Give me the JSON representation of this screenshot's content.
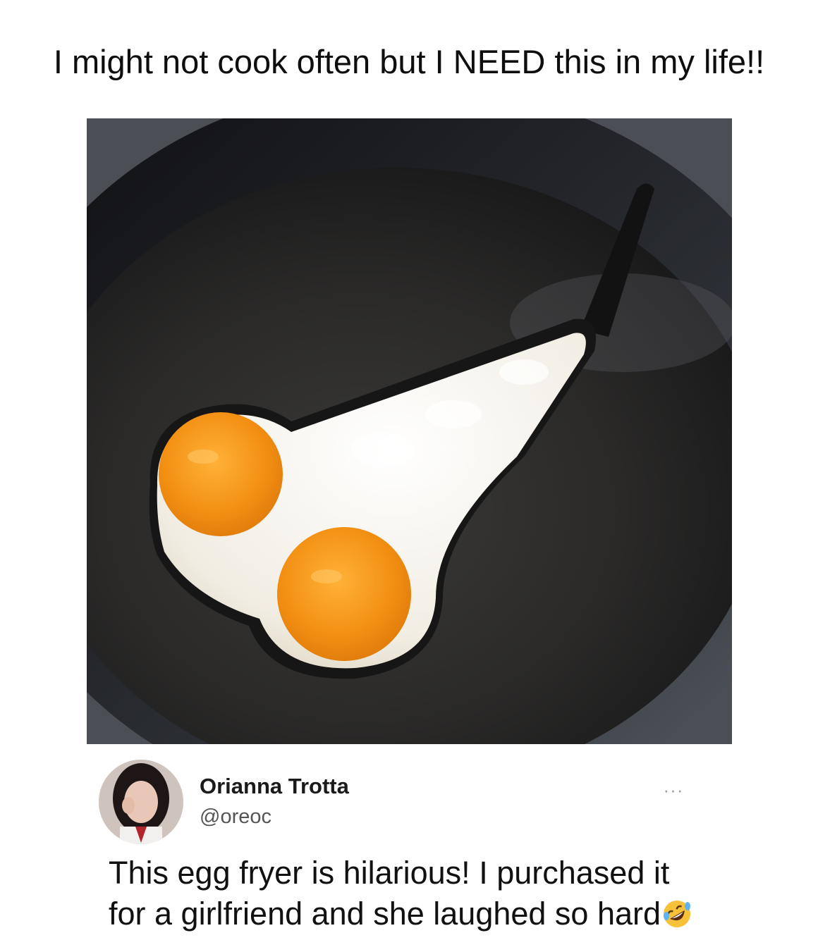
{
  "post": {
    "caption": "I might not cook often but I NEED this in my life!!"
  },
  "photo": {
    "subject": "frying-pan-with-novelty-egg-mold",
    "colors": {
      "pan": "#2a2b2e",
      "mold": "#1c1c1c",
      "egg_white": "#f4f1ea",
      "yolk": "#f39a1c"
    }
  },
  "tweet": {
    "display_name": "Orianna Trotta",
    "handle": "@oreoc",
    "more_label": "···",
    "text_line1": "This egg fryer is hilarious! I purchased it",
    "text_line2": "for a girlfriend and she laughed so hard",
    "emoji": "rolling-on-floor-laughing-emoji"
  }
}
